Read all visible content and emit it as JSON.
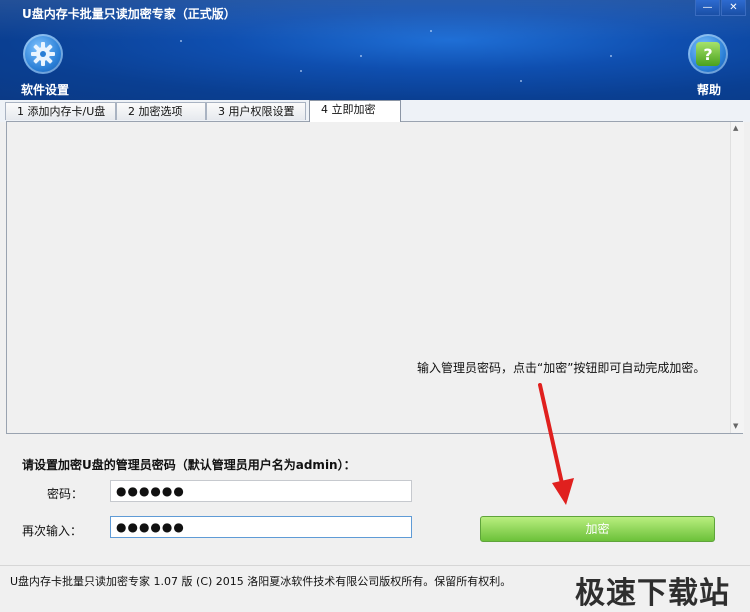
{
  "window": {
    "title": "U盘内存卡批量只读加密专家（正式版）"
  },
  "header": {
    "settings_label": "软件设置",
    "help_label": "帮助",
    "help_glyph": "?",
    "window_controls": {
      "minimize": "—",
      "close": "✕"
    }
  },
  "tabs": [
    {
      "label": "1 添加内存卡/U盘"
    },
    {
      "label": "2 加密选项"
    },
    {
      "label": "3 用户权限设置"
    },
    {
      "label": "4 立即加密"
    }
  ],
  "main": {
    "hint": "输入管理员密码，点击“加密”按钮即可自动完成加密。"
  },
  "form": {
    "section_title": "请设置加密U盘的管理员密码（默认管理员用户名为admin）：",
    "password_label": "密码：",
    "password_value": "●●●●●●",
    "confirm_label": "再次输入：",
    "confirm_value": "●●●●●●",
    "encrypt_label": "加密"
  },
  "footer": {
    "copyright": "U盘内存卡批量只读加密专家 1.07 版 (C) 2015 洛阳夏冰软件技术有限公司版权所有。保留所有权利。",
    "watermark": "极速下载站"
  },
  "colors": {
    "header": "#0f4fb0",
    "encrypt_button": "#6cc13a",
    "arrow": "#e0201e"
  },
  "icons": {
    "settings": "gear-icon",
    "help": "help-icon"
  }
}
